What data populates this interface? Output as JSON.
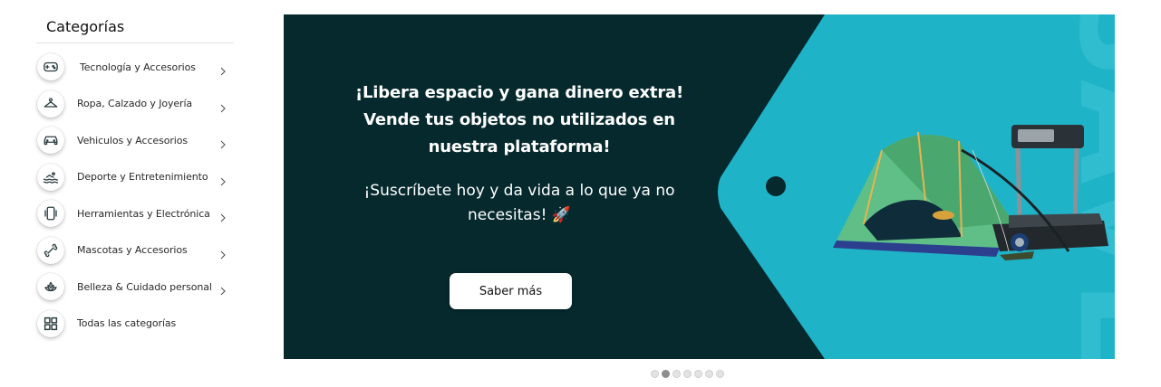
{
  "sidebar": {
    "title": "Categorías",
    "items": [
      {
        "label": "Tecnología y Accesorios",
        "icon": "gamepad-icon",
        "chevron": true
      },
      {
        "label": "Ropa, Calzado y Joyería",
        "icon": "hanger-icon",
        "chevron": true
      },
      {
        "label": "Vehiculos y Accesorios",
        "icon": "car-icon",
        "chevron": true
      },
      {
        "label": "Deporte y Entretenimiento",
        "icon": "swim-icon",
        "chevron": true
      },
      {
        "label": "Herramientas y Electrónica",
        "icon": "phone-icon",
        "chevron": true
      },
      {
        "label": "Mascotas y Accesorios",
        "icon": "bone-icon",
        "chevron": true
      },
      {
        "label": "Belleza &  Cuidado personal",
        "icon": "lotus-icon",
        "chevron": true
      },
      {
        "label": "Todas las categorías",
        "icon": "grid-icon",
        "chevron": false
      }
    ]
  },
  "banner": {
    "title": "¡Libera espacio y gana dinero extra! Vende tus objetos no utilizados en nuestra  plataforma!",
    "subtitle": "¡Suscríbete hoy y da vida a lo que ya no necesitas! 🚀",
    "cta_label": "Saber más",
    "watermark": "SAVE",
    "colors": {
      "dark": "#05292d",
      "tag": "#1fb3c8"
    }
  },
  "carousel": {
    "total": 7,
    "active": 2
  },
  "colors": {
    "icon_stroke": "#2c3e40",
    "accent": "#05292d"
  }
}
